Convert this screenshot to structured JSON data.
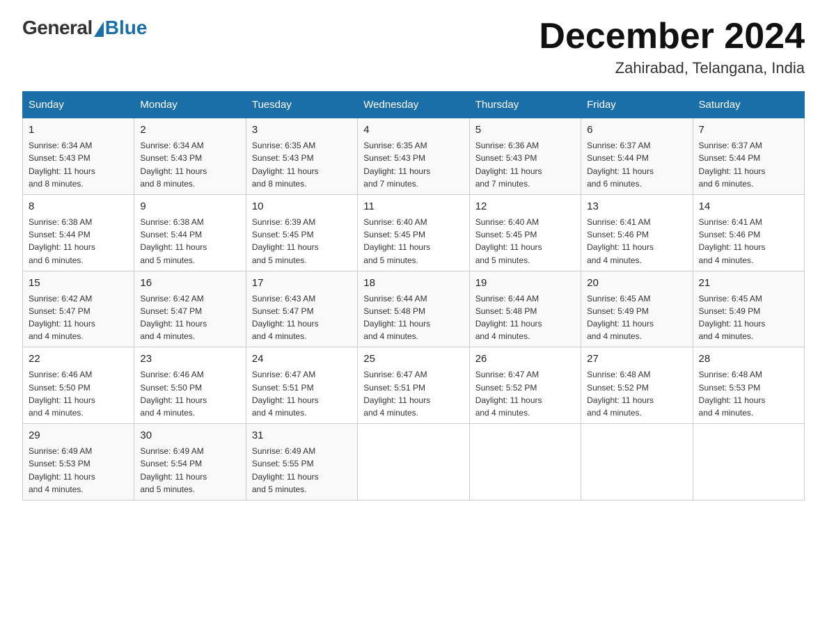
{
  "logo": {
    "general": "General",
    "blue": "Blue",
    "subtitle": ""
  },
  "header": {
    "month_year": "December 2024",
    "location": "Zahirabad, Telangana, India"
  },
  "days_of_week": [
    "Sunday",
    "Monday",
    "Tuesday",
    "Wednesday",
    "Thursday",
    "Friday",
    "Saturday"
  ],
  "weeks": [
    [
      {
        "day": "1",
        "sunrise": "6:34 AM",
        "sunset": "5:43 PM",
        "daylight": "11 hours and 8 minutes."
      },
      {
        "day": "2",
        "sunrise": "6:34 AM",
        "sunset": "5:43 PM",
        "daylight": "11 hours and 8 minutes."
      },
      {
        "day": "3",
        "sunrise": "6:35 AM",
        "sunset": "5:43 PM",
        "daylight": "11 hours and 8 minutes."
      },
      {
        "day": "4",
        "sunrise": "6:35 AM",
        "sunset": "5:43 PM",
        "daylight": "11 hours and 7 minutes."
      },
      {
        "day": "5",
        "sunrise": "6:36 AM",
        "sunset": "5:43 PM",
        "daylight": "11 hours and 7 minutes."
      },
      {
        "day": "6",
        "sunrise": "6:37 AM",
        "sunset": "5:44 PM",
        "daylight": "11 hours and 6 minutes."
      },
      {
        "day": "7",
        "sunrise": "6:37 AM",
        "sunset": "5:44 PM",
        "daylight": "11 hours and 6 minutes."
      }
    ],
    [
      {
        "day": "8",
        "sunrise": "6:38 AM",
        "sunset": "5:44 PM",
        "daylight": "11 hours and 6 minutes."
      },
      {
        "day": "9",
        "sunrise": "6:38 AM",
        "sunset": "5:44 PM",
        "daylight": "11 hours and 5 minutes."
      },
      {
        "day": "10",
        "sunrise": "6:39 AM",
        "sunset": "5:45 PM",
        "daylight": "11 hours and 5 minutes."
      },
      {
        "day": "11",
        "sunrise": "6:40 AM",
        "sunset": "5:45 PM",
        "daylight": "11 hours and 5 minutes."
      },
      {
        "day": "12",
        "sunrise": "6:40 AM",
        "sunset": "5:45 PM",
        "daylight": "11 hours and 5 minutes."
      },
      {
        "day": "13",
        "sunrise": "6:41 AM",
        "sunset": "5:46 PM",
        "daylight": "11 hours and 4 minutes."
      },
      {
        "day": "14",
        "sunrise": "6:41 AM",
        "sunset": "5:46 PM",
        "daylight": "11 hours and 4 minutes."
      }
    ],
    [
      {
        "day": "15",
        "sunrise": "6:42 AM",
        "sunset": "5:47 PM",
        "daylight": "11 hours and 4 minutes."
      },
      {
        "day": "16",
        "sunrise": "6:42 AM",
        "sunset": "5:47 PM",
        "daylight": "11 hours and 4 minutes."
      },
      {
        "day": "17",
        "sunrise": "6:43 AM",
        "sunset": "5:47 PM",
        "daylight": "11 hours and 4 minutes."
      },
      {
        "day": "18",
        "sunrise": "6:44 AM",
        "sunset": "5:48 PM",
        "daylight": "11 hours and 4 minutes."
      },
      {
        "day": "19",
        "sunrise": "6:44 AM",
        "sunset": "5:48 PM",
        "daylight": "11 hours and 4 minutes."
      },
      {
        "day": "20",
        "sunrise": "6:45 AM",
        "sunset": "5:49 PM",
        "daylight": "11 hours and 4 minutes."
      },
      {
        "day": "21",
        "sunrise": "6:45 AM",
        "sunset": "5:49 PM",
        "daylight": "11 hours and 4 minutes."
      }
    ],
    [
      {
        "day": "22",
        "sunrise": "6:46 AM",
        "sunset": "5:50 PM",
        "daylight": "11 hours and 4 minutes."
      },
      {
        "day": "23",
        "sunrise": "6:46 AM",
        "sunset": "5:50 PM",
        "daylight": "11 hours and 4 minutes."
      },
      {
        "day": "24",
        "sunrise": "6:47 AM",
        "sunset": "5:51 PM",
        "daylight": "11 hours and 4 minutes."
      },
      {
        "day": "25",
        "sunrise": "6:47 AM",
        "sunset": "5:51 PM",
        "daylight": "11 hours and 4 minutes."
      },
      {
        "day": "26",
        "sunrise": "6:47 AM",
        "sunset": "5:52 PM",
        "daylight": "11 hours and 4 minutes."
      },
      {
        "day": "27",
        "sunrise": "6:48 AM",
        "sunset": "5:52 PM",
        "daylight": "11 hours and 4 minutes."
      },
      {
        "day": "28",
        "sunrise": "6:48 AM",
        "sunset": "5:53 PM",
        "daylight": "11 hours and 4 minutes."
      }
    ],
    [
      {
        "day": "29",
        "sunrise": "6:49 AM",
        "sunset": "5:53 PM",
        "daylight": "11 hours and 4 minutes."
      },
      {
        "day": "30",
        "sunrise": "6:49 AM",
        "sunset": "5:54 PM",
        "daylight": "11 hours and 5 minutes."
      },
      {
        "day": "31",
        "sunrise": "6:49 AM",
        "sunset": "5:55 PM",
        "daylight": "11 hours and 5 minutes."
      },
      null,
      null,
      null,
      null
    ]
  ],
  "labels": {
    "sunrise": "Sunrise:",
    "sunset": "Sunset:",
    "daylight": "Daylight:"
  }
}
